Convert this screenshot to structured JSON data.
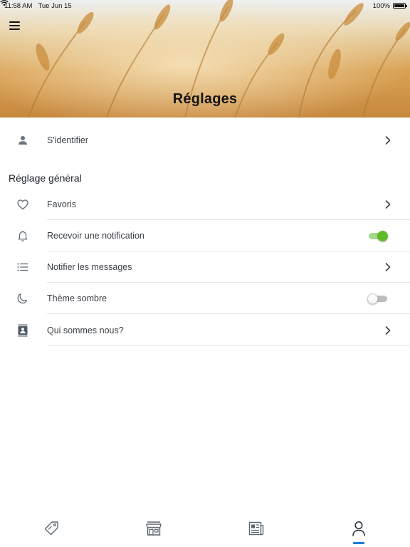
{
  "status_bar": {
    "time": "11:58 AM",
    "date": "Tue Jun 15",
    "battery": "100%"
  },
  "header": {
    "title": "Réglages",
    "menu_icon": "hamburger-menu-icon"
  },
  "login_row": {
    "label": "S'identifier",
    "icon": "person-icon"
  },
  "general_section": {
    "title": "Réglage général",
    "items": [
      {
        "label": "Favoris",
        "icon": "heart-icon",
        "control": "chevron"
      },
      {
        "label": "Recevoir une notification",
        "icon": "bell-icon",
        "control": "toggle",
        "enabled": true
      },
      {
        "label": "Notifier les messages",
        "icon": "list-icon",
        "control": "chevron"
      },
      {
        "label": "Thème sombre",
        "icon": "moon-icon",
        "control": "toggle",
        "enabled": false
      },
      {
        "label": "Qui sommes nous?",
        "icon": "contact-card-icon",
        "control": "chevron"
      }
    ]
  },
  "bottom_nav": {
    "items": [
      {
        "icon": "tag-icon"
      },
      {
        "icon": "store-icon"
      },
      {
        "icon": "newspaper-icon"
      },
      {
        "icon": "profile-icon",
        "active": true
      }
    ]
  },
  "colors": {
    "toggle_on": "#5fba2b",
    "toggle_on_track": "#a6d98a",
    "active_tab_indicator": "#1f7bd6",
    "icon_gray": "#5b6670"
  }
}
